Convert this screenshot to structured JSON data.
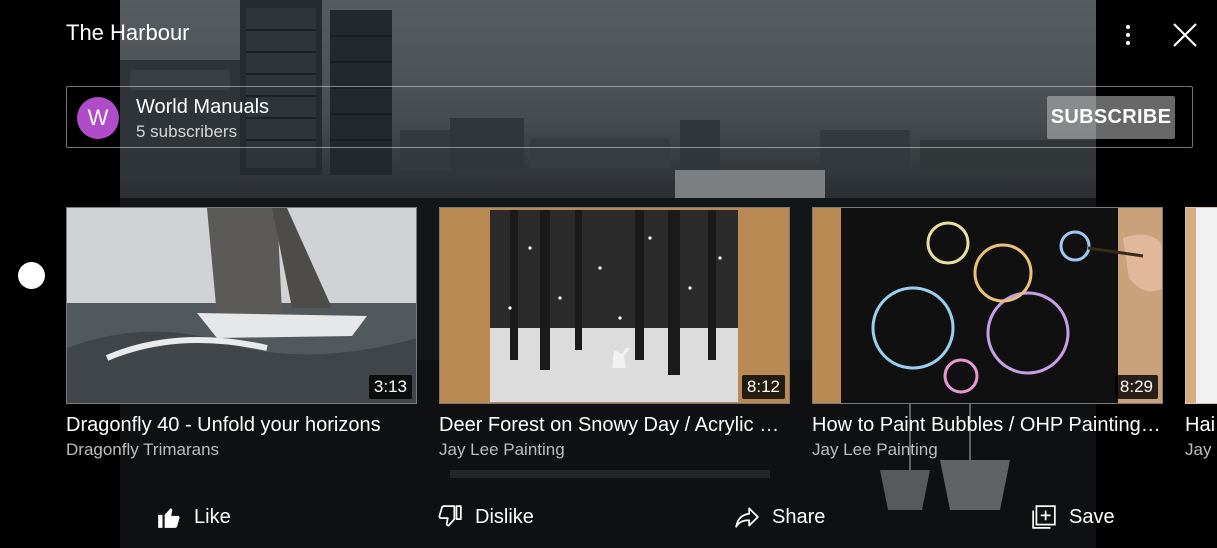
{
  "header": {
    "title": "The Harbour",
    "more_icon": "more-vert-icon",
    "close_icon": "close-icon"
  },
  "channel": {
    "avatar_letter": "W",
    "avatar_color": "#b04bc9",
    "name": "World Manuals",
    "subscribers": "5 subscribers",
    "subscribe_label": "SUBSCRIBE"
  },
  "videos": [
    {
      "title": "Dragonfly 40 - Unfold your horizons",
      "channel": "Dragonfly Trimarans",
      "duration": "3:13"
    },
    {
      "title": "Deer Forest on Snowy Day / Acrylic Painting",
      "channel": "Jay Lee Painting",
      "duration": "8:12"
    },
    {
      "title": "How to Paint Bubbles / OHP Painting Technique",
      "channel": "Jay Lee Painting",
      "duration": "8:29"
    },
    {
      "title": "Hai",
      "channel": "Jay"
    }
  ],
  "actions": {
    "like_label": "Like",
    "dislike_label": "Dislike",
    "share_label": "Share",
    "save_label": "Save"
  }
}
